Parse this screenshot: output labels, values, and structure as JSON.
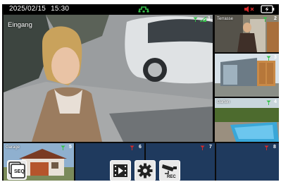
{
  "status": {
    "date": "2025/02/15",
    "time": "15:30",
    "network_icon": "network-icon",
    "mute_icon": "speaker-muted-icon",
    "battery_icon": "battery-charging-icon"
  },
  "colors": {
    "signal_good": "#36c24a",
    "signal_bad": "#d62a2a",
    "empty_channel": "#1f3a5e",
    "statusbar": "#000000"
  },
  "channels": [
    {
      "number": "1",
      "label": "Eingang",
      "signal": "good",
      "feed": "live"
    },
    {
      "number": "2",
      "label": "Terrasse",
      "signal": "good",
      "feed": "live"
    },
    {
      "number": "3",
      "label": "",
      "signal": "good",
      "feed": "live"
    },
    {
      "number": "4",
      "label": "Garten",
      "signal": "good",
      "feed": "live"
    },
    {
      "number": "5",
      "label": "Garage",
      "signal": "good",
      "feed": "live"
    },
    {
      "number": "6",
      "label": "",
      "signal": "none",
      "feed": "empty"
    },
    {
      "number": "7",
      "label": "",
      "signal": "none",
      "feed": "empty"
    },
    {
      "number": "8",
      "label": "",
      "signal": "none",
      "feed": "empty"
    }
  ],
  "controls": {
    "seq_label": "SEQ",
    "rec_label": "REC"
  }
}
